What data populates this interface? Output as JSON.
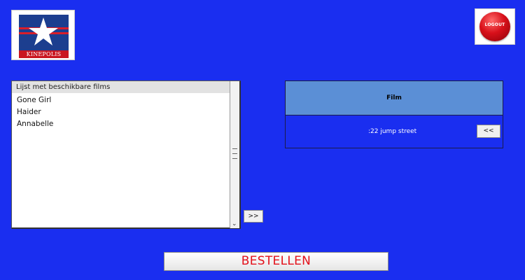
{
  "header": {
    "logo_text": "KINEPOLIS",
    "logout_label": "LOGOUT"
  },
  "available_films": {
    "header": "Lijst met beschikbare films",
    "items": [
      "Gone Girl",
      "Haider",
      "Annabelle"
    ]
  },
  "add_button_label": ">>",
  "selected_films": {
    "header": "Film",
    "items": [
      ":22 jump street"
    ],
    "remove_button_label": "<<"
  },
  "order_button_label": "BESTELLEN",
  "colors": {
    "background": "#1a2ef0",
    "table_header": "#5b8fd6",
    "order_text": "#e3101a",
    "logo_blue": "#1c3e8f",
    "logo_red": "#c9161f"
  }
}
